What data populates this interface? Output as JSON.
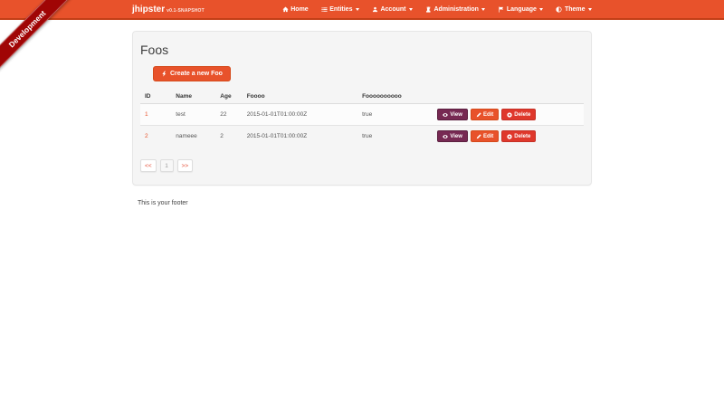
{
  "ribbon": {
    "label": "Development"
  },
  "navbar": {
    "brand": "jhipster",
    "version": "v0.1-SNAPSHOT",
    "items": [
      {
        "label": "Home",
        "icon": "home-icon",
        "caret": false
      },
      {
        "label": "Entities",
        "icon": "list-icon",
        "caret": true
      },
      {
        "label": "Account",
        "icon": "user-icon",
        "caret": true
      },
      {
        "label": "Administration",
        "icon": "tower-icon",
        "caret": true
      },
      {
        "label": "Language",
        "icon": "flag-icon",
        "caret": true
      },
      {
        "label": "Theme",
        "icon": "adjust-icon",
        "caret": true
      }
    ]
  },
  "main": {
    "title": "Foos",
    "create_button_label": "Create a new Foo",
    "table": {
      "headers": [
        "ID",
        "Name",
        "Age",
        "Foooo",
        "Foooooooooo"
      ],
      "rows": [
        [
          "1",
          "test",
          "22",
          "2015-01-01T01:00:00Z",
          "true"
        ],
        [
          "2",
          "nameee",
          "2",
          "2015-01-01T01:00:00Z",
          "true"
        ]
      ],
      "actions": {
        "view": "View",
        "edit": "Edit",
        "delete": "Delete"
      }
    },
    "pagination": {
      "first": "<<",
      "page": "1",
      "last": ">>"
    }
  },
  "footer": {
    "text": "This is your footer"
  },
  "colors": {
    "navbar": "#e8522b",
    "navbar_border": "#c23f17",
    "ribbon": "#a00505",
    "primary": "#e8522b",
    "info_purple": "#772953",
    "danger": "#df382c",
    "link": "#e8522b",
    "panel_bg": "#f5f5f5"
  }
}
